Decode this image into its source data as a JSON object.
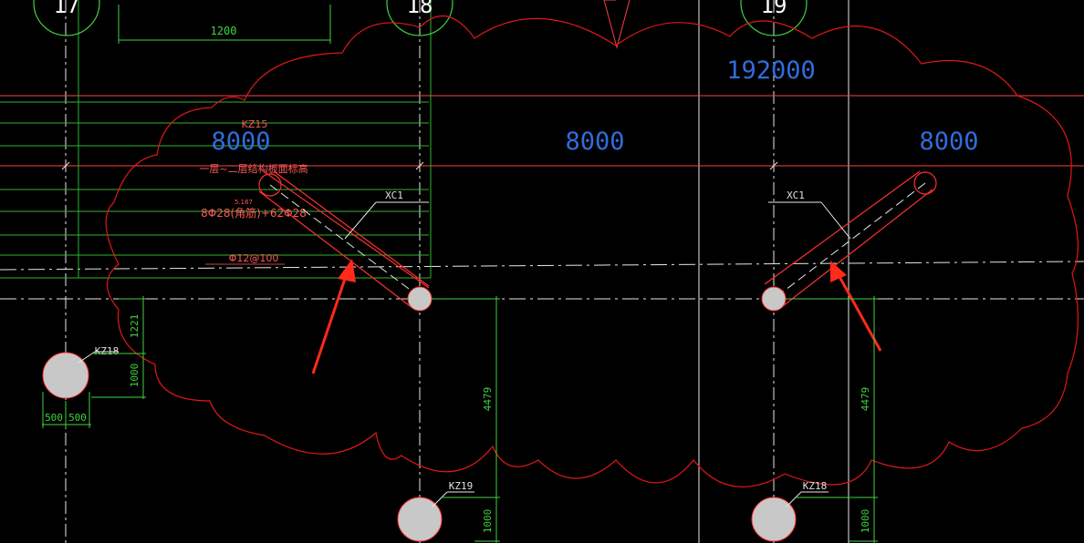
{
  "axis_labels": {
    "a17": "17",
    "a18": "18",
    "a19": "19"
  },
  "dimensions": {
    "top_span": "1200",
    "total_length": "192000",
    "span_1": "8000",
    "span_2": "8000",
    "span_3": "8000",
    "left_vertical_upper": "1221",
    "left_vertical_lower": "1000",
    "left_bottom_a": "500",
    "left_bottom_b": "500",
    "mid_vertical": "4479",
    "mid_bottom": "1000",
    "right_vertical": "4479",
    "right_bottom": "1000"
  },
  "columns": {
    "kz15": "KZ15",
    "kz18_left": "KZ18",
    "kz19": "KZ19",
    "kz18_right": "KZ18"
  },
  "braces": {
    "xc1_left": "XC1",
    "xc1_right": "XC1"
  },
  "annotations": {
    "level_note": "一层~二层结构板面标高",
    "small_note": "5.167",
    "rebar_main": "8Φ28(角筋)+62Φ28",
    "rebar_stirrup": "Φ12@100"
  },
  "colors": {
    "background": "#000000",
    "dimension_green": "#3fd23f",
    "cloud_red": "#e01818",
    "span_blue": "#2f6ddc",
    "arrow_red": "#ff2a1a",
    "column_fill": "#c8c8c8"
  }
}
